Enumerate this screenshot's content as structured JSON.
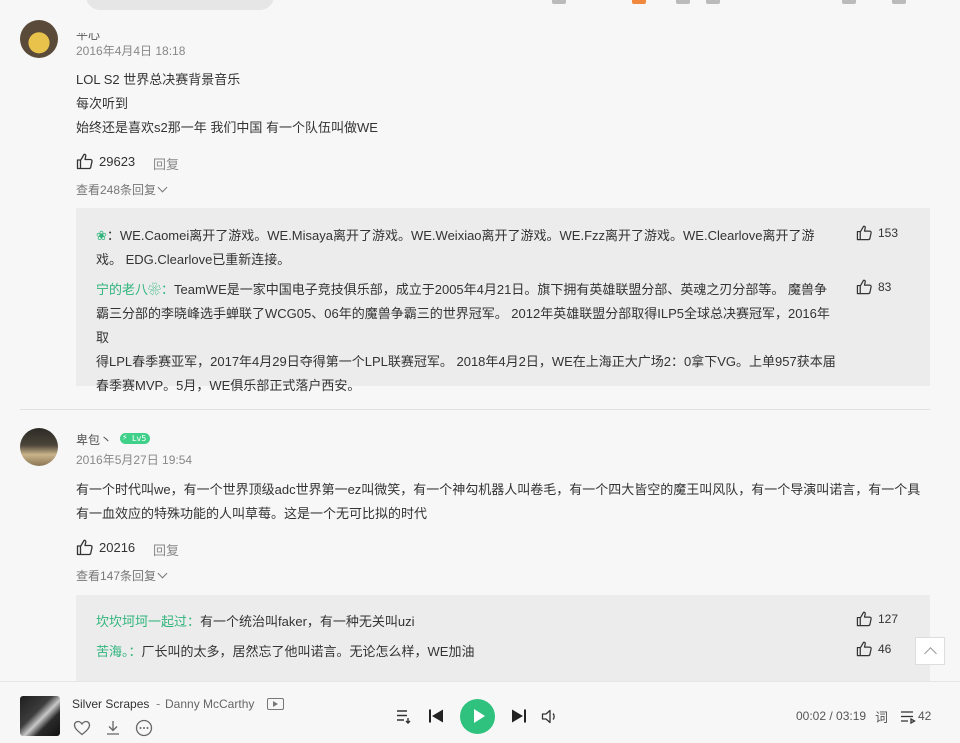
{
  "comments": [
    {
      "username": "平心",
      "badge": "",
      "date": "2016年4月4日 18:18",
      "lines": [
        "LOL S2 世界总决赛背景音乐",
        "每次听到",
        "始终还是喜欢s2那一年 我们中国 有一个队伍叫做WE"
      ],
      "likes": "29623",
      "reply_label": "回复",
      "see_more": "查看248条回复",
      "replies": [
        {
          "name": "❀",
          "line1": "：WE.Caomei离开了游戏。WE.Misaya离开了游戏。WE.Weixiao离开了游戏。WE.Fzz离开了游戏。WE.Clearlove离开了游",
          "line2": "戏。 EDG.Clearlove已重新连接。",
          "likes": "153"
        },
        {
          "name": "宁的老八❀：",
          "line1": "TeamWE是一家中国电子竞技俱乐部，成立于2005年4月21日。旗下拥有英雄联盟分部、英魂之刃分部等。 魔兽争",
          "line2": "霸三分部的李晓峰选手蝉联了WCG05、06年的魔兽争霸三的世界冠军。 2012年英雄联盟分部取得ILP5全球总决赛冠军，2016年取",
          "line3": "得LPL春季赛亚军，2017年4月29日夺得第一个LPL联赛冠军。 2018年4月2日，WE在上海正大广场2：0拿下VG。上单957获本届",
          "line4": "春季赛MVP。5月，WE俱乐部正式落户西安。",
          "likes": "83"
        }
      ]
    },
    {
      "username": "卑包丶",
      "badge": "Lv5",
      "date": "2016年5月27日 19:54",
      "lines": [
        "有一个时代叫we，有一个世界顶级adc世界第一ez叫微笑，有一个神勾机器人叫卷毛，有一个四大皆空的魔王叫风队，有一个导演叫诺言，有一个具",
        "有一血效应的特殊功能的人叫草莓。这是一个无可比拟的时代"
      ],
      "likes": "20216",
      "reply_label": "回复",
      "see_more": "查看147条回复",
      "replies": [
        {
          "name": "坎坎坷坷一起过：",
          "line1": "有一个统治叫faker，有一种无关叫uzi",
          "likes": "127"
        },
        {
          "name": "苦海。：",
          "line1": "厂长叫的太多，居然忘了他叫诺言。无论怎么样，WE加油",
          "likes": "46"
        }
      ]
    }
  ],
  "player": {
    "song": "Silver Scrapes",
    "separator": "-",
    "artist": "Danny McCarthy",
    "time": "00:02 / 03:19",
    "lyric_label": "词",
    "playlist_count": "42"
  },
  "colors": {
    "accent": "#2ec27e",
    "reply_name": "#2fb57c"
  }
}
